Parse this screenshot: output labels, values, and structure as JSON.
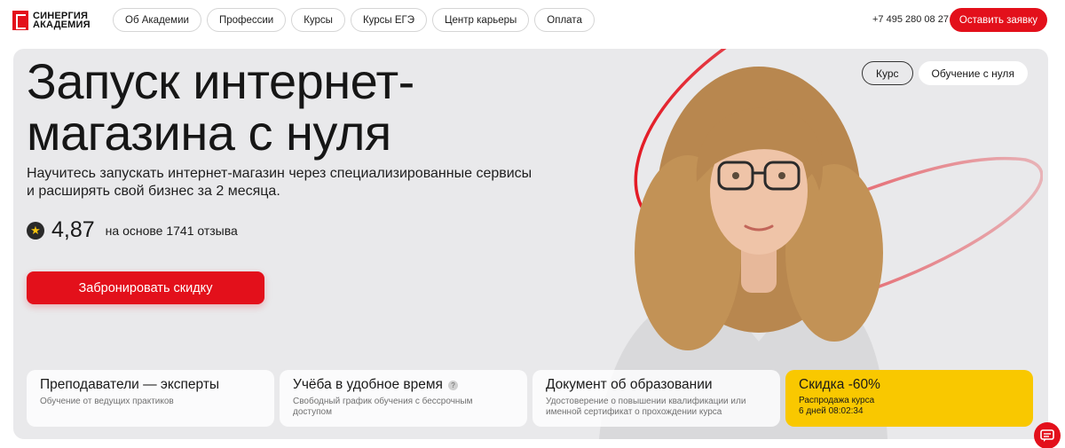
{
  "header": {
    "logo_line1": "СИНЕРГИЯ",
    "logo_line2": "АКАДЕМИЯ",
    "nav": [
      {
        "label": "Об Академии"
      },
      {
        "label": "Профессии"
      },
      {
        "label": "Курсы"
      },
      {
        "label": "Курсы ЕГЭ"
      },
      {
        "label": "Центр карьеры"
      },
      {
        "label": "Оплата"
      }
    ],
    "phone": "+7 495 280 08 27",
    "cta": "Оставить заявку"
  },
  "hero": {
    "title": "Запуск интернет-магазина с нуля",
    "subtitle": "Научитесь запускать интернет-магазин через специализированные сервисы и расширять свой бизнес за 2 месяца.",
    "rating_value": "4,87",
    "rating_text": "на основе 1741 отзыва",
    "cta": "Забронировать скидку",
    "tags": [
      {
        "label": "Курс"
      },
      {
        "label": "Обучение с нуля"
      }
    ],
    "cards": [
      {
        "title": "Преподаватели — эксперты",
        "desc": "Обучение от ведущих практиков"
      },
      {
        "title": "Учёба в удобное время",
        "desc": "Свободный график обучения с бессрочным доступом"
      },
      {
        "title": "Документ об образовании",
        "desc": "Удостоверение о повышении квалификации или именной сертификат о прохождении курса"
      },
      {
        "title": "Скидка -60%",
        "desc_line1": "Распродажа курса",
        "desc_line2": "6 дней 08:02:34"
      }
    ]
  },
  "colors": {
    "brand_red": "#e3101b",
    "promo_yellow": "#f9c800",
    "hero_bg": "#e9e9eb"
  },
  "icons": {
    "logo": "synergy-logo-icon",
    "rating": "star-icon",
    "help": "question-icon",
    "chat": "chat-icon"
  }
}
